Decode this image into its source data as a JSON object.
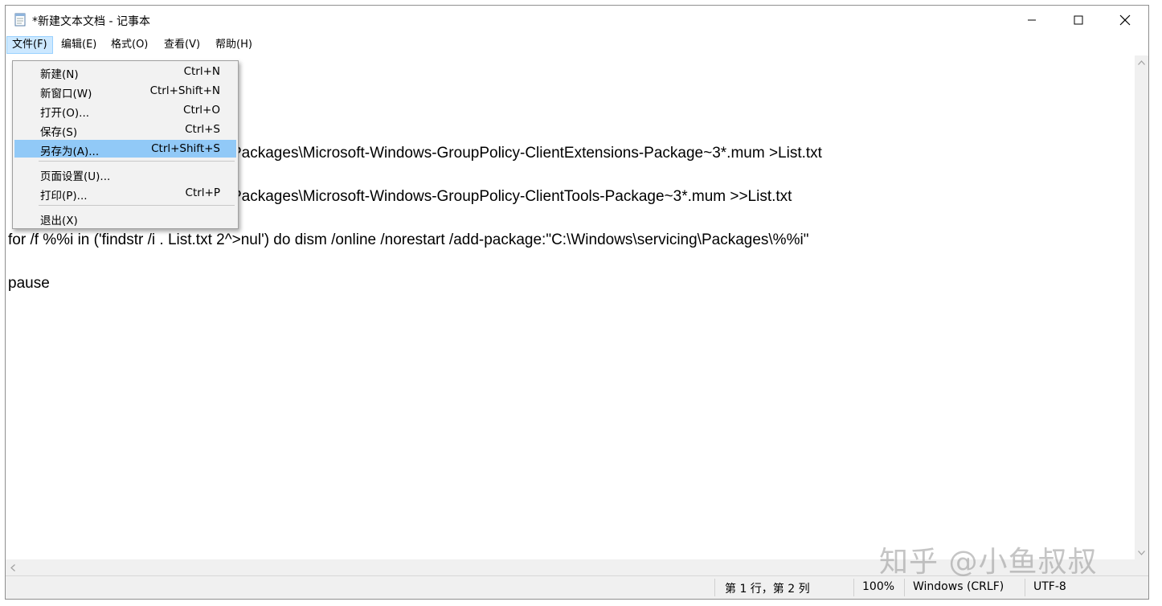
{
  "window": {
    "title": "*新建文本文档 - 记事本"
  },
  "menubar": {
    "items": [
      {
        "label": "文件(F)"
      },
      {
        "label": "编辑(E)"
      },
      {
        "label": "格式(O)"
      },
      {
        "label": "查看(V)"
      },
      {
        "label": "帮助(H)"
      }
    ]
  },
  "file_menu": {
    "items": [
      {
        "label": "新建(N)",
        "shortcut": "Ctrl+N"
      },
      {
        "label": "新窗口(W)",
        "shortcut": "Ctrl+Shift+N"
      },
      {
        "label": "打开(O)...",
        "shortcut": "Ctrl+O"
      },
      {
        "label": "保存(S)",
        "shortcut": "Ctrl+S"
      },
      {
        "label": "另存为(A)...",
        "shortcut": "Ctrl+Shift+S",
        "selected": true
      },
      {
        "label": "页面设置(U)...",
        "shortcut": ""
      },
      {
        "label": "打印(P)...",
        "shortcut": "Ctrl+P"
      },
      {
        "label": "退出(X)",
        "shortcut": ""
      }
    ]
  },
  "editor": {
    "lines": [
      "Packages\\Microsoft-Windows-GroupPolicy-ClientExtensions-Package~3*.mum >List.txt",
      "Packages\\Microsoft-Windows-GroupPolicy-ClientTools-Package~3*.mum >>List.txt",
      "for /f %%i in ('findstr /i . List.txt 2^>nul') do dism /online /norestart /add-package:\"C:\\Windows\\servicing\\Packages\\%%i\"",
      "pause"
    ]
  },
  "statusbar": {
    "position": "第 1 行，第 2 列",
    "zoom": "100%",
    "line_ending": "Windows (CRLF)",
    "encoding": "UTF-8"
  },
  "watermark": {
    "text": "知乎 @小鱼叔叔"
  },
  "colors": {
    "menu_active_bg": "#cce8ff",
    "menu_selected_bg": "#91c9f7",
    "dropdown_bg": "#f2f2f2",
    "chrome_bg": "#f0f0f0"
  }
}
